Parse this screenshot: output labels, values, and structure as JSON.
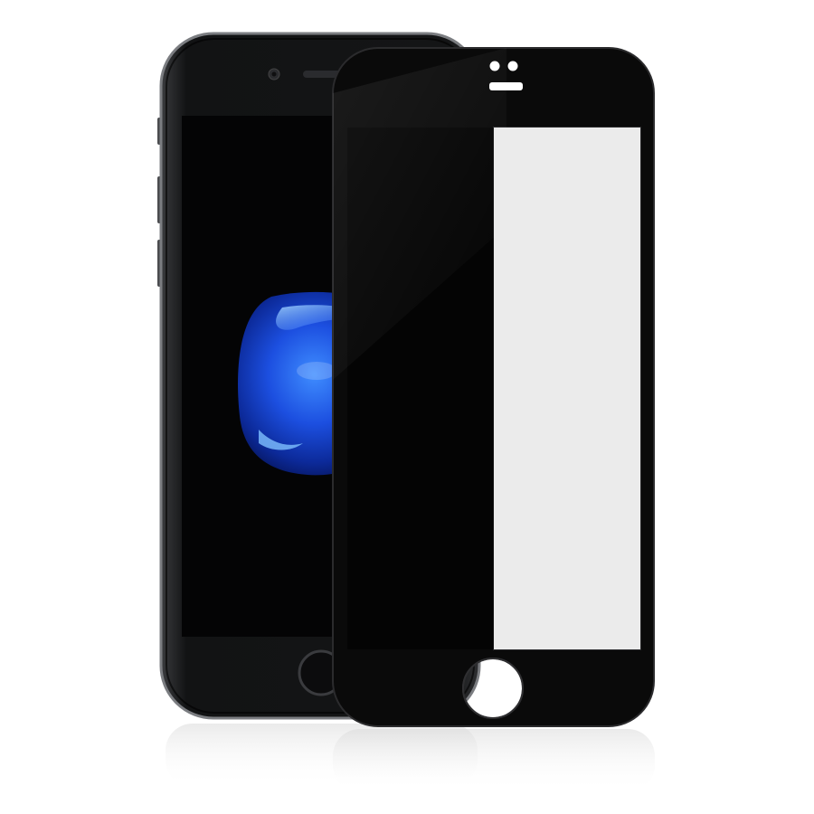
{
  "scene": {
    "subject": "tempered-glass-screen-protector-product-photo",
    "items": [
      {
        "name": "phone",
        "color": "black"
      },
      {
        "name": "screen-protector",
        "color": "black",
        "style": "full-cover"
      }
    ]
  },
  "colors": {
    "background": "#ffffff",
    "phone_body": "#1c1d1f",
    "phone_edge": "#6b6d71",
    "phone_screen": "#050506",
    "protector_frame": "#0a0a0a",
    "protector_window": "#ebebeb",
    "wallpaper_blue": "#1f5cff"
  }
}
